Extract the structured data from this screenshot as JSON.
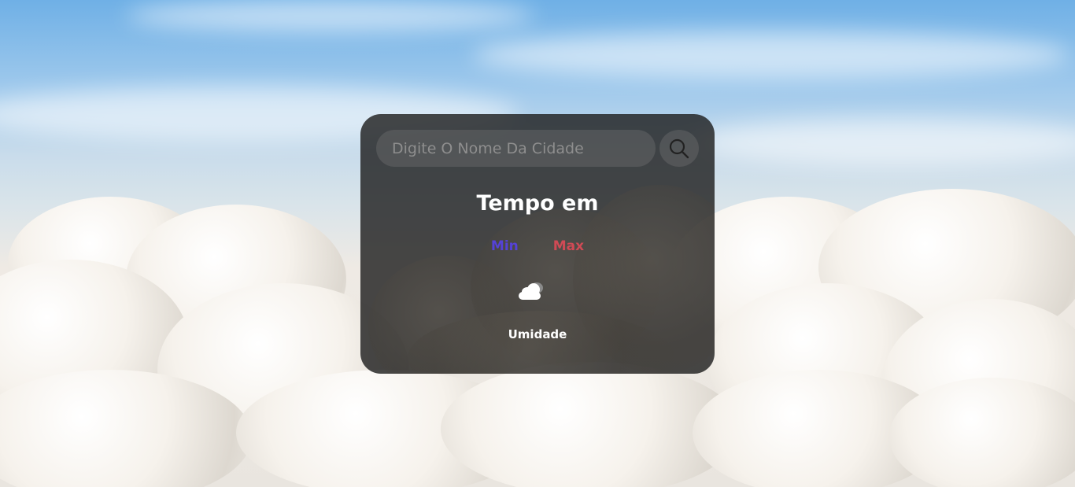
{
  "search": {
    "placeholder": "Digite O Nome Da Cidade",
    "value": "",
    "button_icon": "search-icon"
  },
  "weather": {
    "title": "Tempo em",
    "min_label": "Min",
    "max_label": "Max",
    "icon": "cloud-icon",
    "humidity_label": "Umidade"
  },
  "colors": {
    "min": "#5542d6",
    "max": "#d04a55",
    "card_bg": "#1c1c1c"
  }
}
